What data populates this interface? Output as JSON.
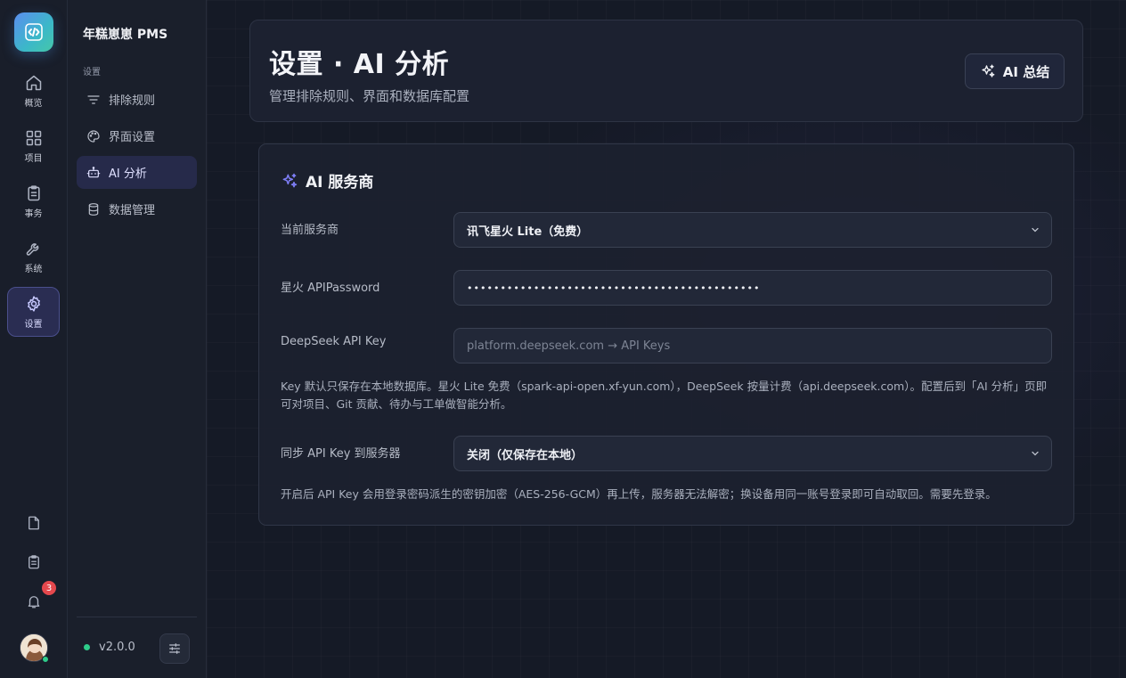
{
  "app": {
    "brand": "年糕崽崽 PMS",
    "version": "v2.0.0",
    "notification_count": "3"
  },
  "rail": {
    "items": [
      {
        "label": "概览",
        "icon": "home-icon"
      },
      {
        "label": "项目",
        "icon": "grid-icon"
      },
      {
        "label": "事务",
        "icon": "clipboard-icon"
      },
      {
        "label": "系统",
        "icon": "wrench-icon"
      },
      {
        "label": "设置",
        "icon": "gear-icon"
      }
    ],
    "active": "设置"
  },
  "subnav": {
    "section": "设置",
    "items": [
      {
        "label": "排除规则",
        "icon": "filter-icon"
      },
      {
        "label": "界面设置",
        "icon": "palette-icon"
      },
      {
        "label": "AI 分析",
        "icon": "robot-icon"
      },
      {
        "label": "数据管理",
        "icon": "database-icon"
      }
    ],
    "active": "AI 分析"
  },
  "header": {
    "title": "设置 · AI 分析",
    "subtitle": "管理排除规则、界面和数据库配置",
    "ai_summary_button": "AI 总结"
  },
  "provider_card": {
    "title": "AI 服务商",
    "current_provider_label": "当前服务商",
    "current_provider_value": "讯飞星火 Lite（免费）",
    "spark_password_label": "星火 APIPassword",
    "spark_password_value": "••••••••••••••••••••••••••••••••••••••••••••",
    "deepseek_key_label": "DeepSeek API Key",
    "deepseek_key_placeholder": "platform.deepseek.com → API Keys",
    "key_note": "Key 默认只保存在本地数据库。星火 Lite 免费（spark-api-open.xf-yun.com），DeepSeek 按量计费（api.deepseek.com）。配置后到「AI 分析」页即可对项目、Git 贡献、待办与工单做智能分析。",
    "sync_label": "同步 API Key 到服务器",
    "sync_value": "关闭（仅保存在本地）",
    "sync_note": "开启后 API Key 会用登录密码派生的密钥加密（AES-256-GCM）再上传，服务器无法解密；换设备用同一账号登录即可自动取回。需要先登录。"
  },
  "colors": {
    "accent": "#6c6cf0",
    "active_bg": "#2a2d52",
    "online": "#2ecc8a",
    "badge": "#e5484d"
  }
}
